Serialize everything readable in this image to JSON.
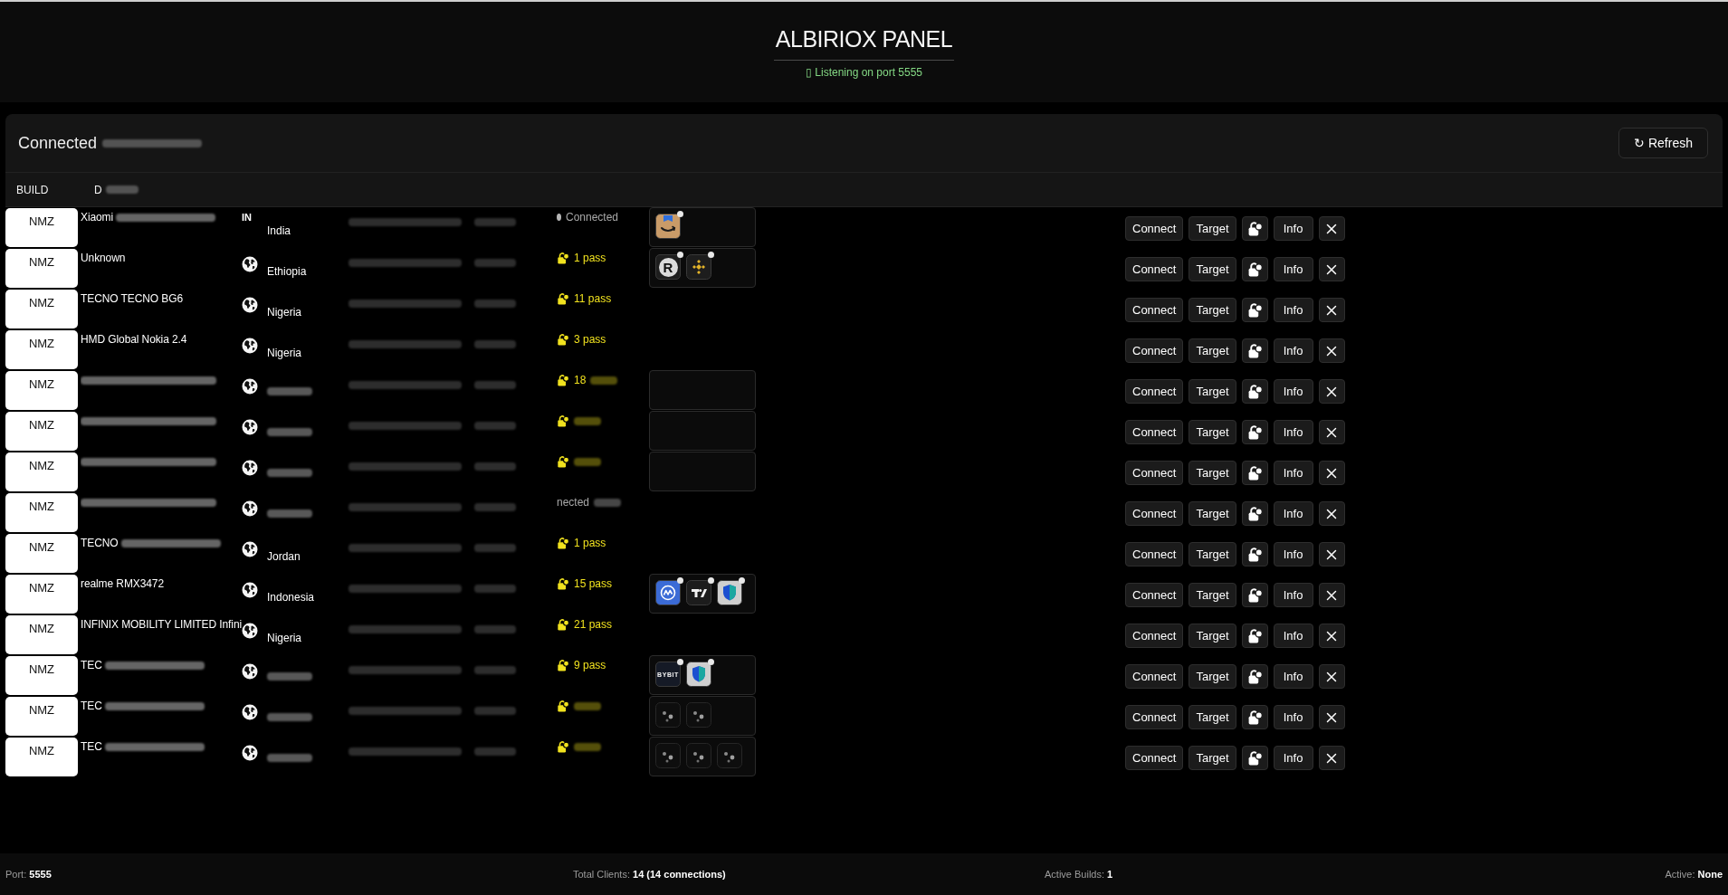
{
  "header": {
    "title": "ALBIRIOX PANEL",
    "subtitle": "▯ Listening on port 5555"
  },
  "clients": {
    "title": "Connected",
    "title_smudged": true,
    "refresh": "↻ Refresh",
    "columns": [
      {
        "label": "BUILD",
        "smudged": false
      },
      {
        "label": "D",
        "smudged": true
      }
    ],
    "rows": [
      {
        "build": "NMZ",
        "device": "Xiaomi",
        "device_smudged": true,
        "flag": {
          "kind": "code",
          "text": "IN"
        },
        "country": "India",
        "country_smudged": false,
        "status": {
          "kind": "connected",
          "text": "Connected"
        },
        "status_smudged": false,
        "apps_panel": true,
        "apps": [
          {
            "kind": "smile-box",
            "badge": true
          }
        ],
        "actions": [
          {
            "kind": "text",
            "label": "Connect"
          },
          {
            "kind": "text",
            "label": "Target"
          },
          {
            "kind": "lock"
          },
          {
            "kind": "text",
            "label": "Info"
          },
          {
            "kind": "close"
          }
        ]
      },
      {
        "build": "NMZ",
        "device": "Unknown",
        "device_smudged": false,
        "flag": {
          "kind": "globe"
        },
        "country": "Ethiopia",
        "country_smudged": false,
        "status": {
          "kind": "pass",
          "text": "1 pass"
        },
        "status_smudged": false,
        "apps_panel": true,
        "apps": [
          {
            "kind": "letter",
            "label": "R",
            "badge": true
          },
          {
            "kind": "diamond",
            "badge": true
          }
        ],
        "actions": [
          {
            "kind": "text",
            "label": "Connect"
          },
          {
            "kind": "text",
            "label": "Target"
          },
          {
            "kind": "lock"
          },
          {
            "kind": "text",
            "label": "Info"
          },
          {
            "kind": "close"
          }
        ]
      },
      {
        "build": "NMZ",
        "device": "TECNO TECNO BG6",
        "device_smudged": false,
        "flag": {
          "kind": "globe"
        },
        "country": "Nigeria",
        "country_smudged": false,
        "status": {
          "kind": "pass",
          "text": "11 pass"
        },
        "status_smudged": false,
        "apps_panel": false,
        "actions": [
          {
            "kind": "text",
            "label": "Connect"
          },
          {
            "kind": "text",
            "label": "Target"
          },
          {
            "kind": "lock"
          },
          {
            "kind": "text",
            "label": "Info"
          },
          {
            "kind": "close"
          }
        ]
      },
      {
        "build": "NMZ",
        "device": "HMD Global Nokia 2.4",
        "device_smudged": false,
        "flag": {
          "kind": "globe"
        },
        "country": "Nigeria",
        "country_smudged": false,
        "status": {
          "kind": "pass",
          "text": "3 pass"
        },
        "status_smudged": false,
        "apps_panel": false,
        "actions": [
          {
            "kind": "text",
            "label": "Connect"
          },
          {
            "kind": "text",
            "label": "Target"
          },
          {
            "kind": "lock"
          },
          {
            "kind": "text",
            "label": "Info"
          },
          {
            "kind": "close"
          }
        ]
      },
      {
        "build": "NMZ",
        "device_smudged": true,
        "flag": {
          "kind": "globe"
        },
        "country_smudged": true,
        "status": {
          "kind": "pass",
          "text": "18"
        },
        "status_smudged": true,
        "apps_panel": true,
        "actions": [
          {
            "kind": "text",
            "label": "Connect"
          },
          {
            "kind": "text",
            "label": "Target"
          },
          {
            "kind": "lock"
          },
          {
            "kind": "text",
            "label": "Info"
          },
          {
            "kind": "close"
          }
        ]
      },
      {
        "build": "NMZ",
        "device_smudged": true,
        "flag": {
          "kind": "globe"
        },
        "country_smudged": true,
        "status": {
          "kind": "pass"
        },
        "status_smudged": true,
        "apps_panel": true,
        "actions": [
          {
            "kind": "text",
            "label": "Connect"
          },
          {
            "kind": "text",
            "label": "Target"
          },
          {
            "kind": "lock"
          },
          {
            "kind": "text",
            "label": "Info"
          },
          {
            "kind": "close"
          }
        ]
      },
      {
        "build": "NMZ",
        "device_smudged": true,
        "flag": {
          "kind": "globe"
        },
        "country_smudged": true,
        "status": {
          "kind": "pass"
        },
        "status_smudged": true,
        "apps_panel": true,
        "actions": [
          {
            "kind": "text",
            "label": "Connect"
          },
          {
            "kind": "text",
            "label": "Target"
          },
          {
            "kind": "lock"
          },
          {
            "kind": "text",
            "label": "Info"
          },
          {
            "kind": "close"
          }
        ]
      },
      {
        "build": "NMZ",
        "device_smudged": true,
        "flag": {
          "kind": "globe"
        },
        "country_smudged": true,
        "status": {
          "kind": "plain",
          "text": "nected"
        },
        "status_smudged": true,
        "apps_panel": false,
        "actions": [
          {
            "kind": "text",
            "label": "Connect"
          },
          {
            "kind": "text",
            "label": "Target"
          },
          {
            "kind": "lock"
          },
          {
            "kind": "text",
            "label": "Info"
          },
          {
            "kind": "close"
          }
        ]
      },
      {
        "build": "NMZ",
        "device": "TECNO",
        "device_smudged": true,
        "flag": {
          "kind": "globe"
        },
        "country": "Jordan",
        "country_smudged": false,
        "status": {
          "kind": "pass",
          "text": "1 pass"
        },
        "status_smudged": false,
        "apps_panel": false,
        "actions": [
          {
            "kind": "text",
            "label": "Connect"
          },
          {
            "kind": "text",
            "label": "Target"
          },
          {
            "kind": "lock"
          },
          {
            "kind": "text",
            "label": "Info"
          },
          {
            "kind": "close"
          }
        ]
      },
      {
        "build": "NMZ",
        "device": "realme RMX3472",
        "device_smudged": false,
        "flag": {
          "kind": "globe"
        },
        "country": "Indonesia",
        "country_smudged": false,
        "status": {
          "kind": "pass",
          "text": "15 pass"
        },
        "status_smudged": false,
        "apps_panel": true,
        "apps": [
          {
            "kind": "wave",
            "badge": true
          },
          {
            "kind": "tshape",
            "badge": true
          },
          {
            "kind": "shield",
            "badge": true
          }
        ],
        "actions": [
          {
            "kind": "text",
            "label": "Connect"
          },
          {
            "kind": "text",
            "label": "Target"
          },
          {
            "kind": "lock"
          },
          {
            "kind": "text",
            "label": "Info"
          },
          {
            "kind": "close"
          }
        ]
      },
      {
        "build": "NMZ",
        "device": "INFINIX MOBILITY LIMITED Infini",
        "device_smudged": false,
        "flag": {
          "kind": "globe"
        },
        "country": "Nigeria",
        "country_smudged": false,
        "status": {
          "kind": "pass",
          "text": "21 pass"
        },
        "status_smudged": false,
        "apps_panel": false,
        "actions": [
          {
            "kind": "text",
            "label": "Connect"
          },
          {
            "kind": "text",
            "label": "Target"
          },
          {
            "kind": "lock"
          },
          {
            "kind": "text",
            "label": "Info"
          },
          {
            "kind": "close"
          }
        ]
      },
      {
        "build": "NMZ",
        "device": "TEC",
        "device_smudged": true,
        "flag": {
          "kind": "globe"
        },
        "country_smudged": true,
        "status": {
          "kind": "pass",
          "text": "9 pass"
        },
        "status_smudged": false,
        "apps_panel": true,
        "apps": [
          {
            "kind": "wordmark",
            "label": "BYBIT",
            "badge": true
          },
          {
            "kind": "shield",
            "badge": true
          }
        ],
        "actions": [
          {
            "kind": "text",
            "label": "Connect"
          },
          {
            "kind": "text",
            "label": "Target"
          },
          {
            "kind": "lock"
          },
          {
            "kind": "text",
            "label": "Info"
          },
          {
            "kind": "close"
          }
        ]
      },
      {
        "build": "NMZ",
        "device": "TEC",
        "device_smudged": true,
        "flag": {
          "kind": "globe"
        },
        "country_smudged": true,
        "status": {
          "kind": "pass"
        },
        "status_smudged": true,
        "apps_panel": true,
        "apps": [
          {
            "kind": "faint",
            "badge": false
          },
          {
            "kind": "faint",
            "badge": false
          }
        ],
        "actions": [
          {
            "kind": "text",
            "label": "Connect"
          },
          {
            "kind": "text",
            "label": "Target"
          },
          {
            "kind": "lock"
          },
          {
            "kind": "text",
            "label": "Info"
          },
          {
            "kind": "close"
          }
        ]
      },
      {
        "build": "NMZ",
        "device": "TEC",
        "device_smudged": true,
        "flag": {
          "kind": "globe"
        },
        "country_smudged": true,
        "status": {
          "kind": "pass"
        },
        "status_smudged": true,
        "apps_panel": true,
        "apps": [
          {
            "kind": "faint",
            "badge": false
          },
          {
            "kind": "faint",
            "badge": false
          },
          {
            "kind": "faint",
            "badge": false
          }
        ],
        "actions": [
          {
            "kind": "text",
            "label": "Connect"
          },
          {
            "kind": "text",
            "label": "Target"
          },
          {
            "kind": "lock"
          },
          {
            "kind": "text",
            "label": "Info"
          },
          {
            "kind": "close"
          }
        ]
      }
    ]
  },
  "status_bar": [
    "Port: **5555**",
    "Total Clients: **14 (14 connections)**",
    "Active Builds: **1**",
    "Active: **None**"
  ]
}
